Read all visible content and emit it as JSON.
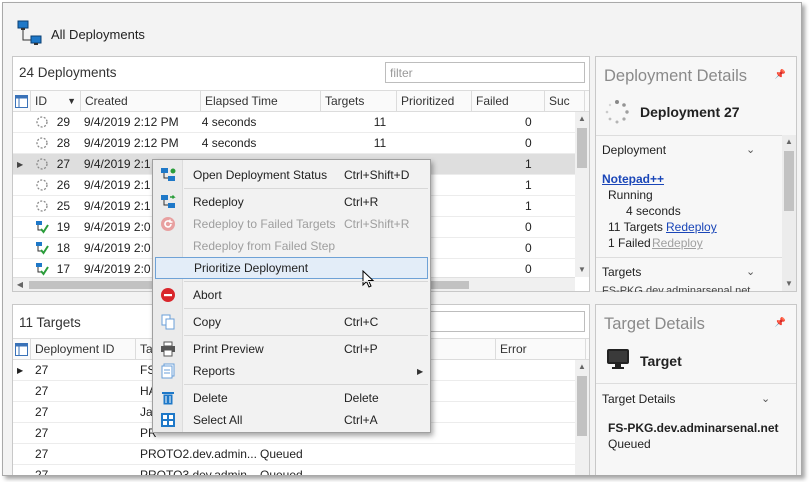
{
  "header": {
    "title": "All Deployments"
  },
  "deployments": {
    "title": "24 Deployments",
    "filter_placeholder": "filter",
    "columns": [
      "ID",
      "Created",
      "Elapsed Time",
      "Targets",
      "Prioritized",
      "Failed",
      "Suc"
    ],
    "rows": [
      {
        "id": "29",
        "created": "9/4/2019 2:12 PM",
        "elapsed": "4 seconds",
        "targets": "11",
        "prioritized": "",
        "failed": "0",
        "status": "running"
      },
      {
        "id": "28",
        "created": "9/4/2019 2:12 PM",
        "elapsed": "4 seconds",
        "targets": "11",
        "prioritized": "",
        "failed": "0",
        "status": "running"
      },
      {
        "id": "27",
        "created": "9/4/2019 2:1",
        "elapsed": "",
        "targets": "",
        "prioritized": "",
        "failed": "1",
        "status": "running"
      },
      {
        "id": "26",
        "created": "9/4/2019 2:1",
        "elapsed": "",
        "targets": "",
        "prioritized": "",
        "failed": "1",
        "status": "running"
      },
      {
        "id": "25",
        "created": "9/4/2019 2:1",
        "elapsed": "",
        "targets": "",
        "prioritized": "",
        "failed": "1",
        "status": "running"
      },
      {
        "id": "19",
        "created": "9/4/2019 2:0",
        "elapsed": "",
        "targets": "",
        "prioritized": "",
        "failed": "0",
        "status": "success"
      },
      {
        "id": "18",
        "created": "9/4/2019 2:0",
        "elapsed": "",
        "targets": "",
        "prioritized": "",
        "failed": "0",
        "status": "success"
      },
      {
        "id": "17",
        "created": "9/4/2019 2:0",
        "elapsed": "",
        "targets": "",
        "prioritized": "",
        "failed": "0",
        "status": "success"
      }
    ]
  },
  "targets": {
    "title": "11 Targets",
    "columns": [
      "Deployment ID",
      "Ta",
      "",
      "Error"
    ],
    "rows": [
      {
        "deployment_id": "27",
        "target": "FS",
        "status": ""
      },
      {
        "deployment_id": "27",
        "target": "HA",
        "status": ""
      },
      {
        "deployment_id": "27",
        "target": "Ja",
        "status": ""
      },
      {
        "deployment_id": "27",
        "target": "PR",
        "status": ""
      },
      {
        "deployment_id": "27",
        "target": "PROTO2.dev.admin...",
        "status": "Queued"
      },
      {
        "deployment_id": "27",
        "target": "PROTO3.dev.admin...",
        "status": "Queued"
      }
    ]
  },
  "deployment_details": {
    "title": "Deployment Details",
    "name": "Deployment 27",
    "section": "Deployment",
    "package_link": "Notepad++",
    "state": "Running",
    "elapsed": "4 seconds",
    "targets_text": "11 Targets",
    "redeploy_link": "Redeploy",
    "failed_text": "1 Failed",
    "redeploy_failed_link": "Redeploy",
    "targets_section": "Targets",
    "targets_cut": "FS-PKG.dev.adminarsenal.net"
  },
  "target_details": {
    "title": "Target Details",
    "name": "Target",
    "section": "Target Details",
    "host": "FS-PKG.dev.adminarsenal.net",
    "status": "Queued"
  },
  "context_menu": {
    "items": [
      {
        "label": "Open Deployment Status",
        "shortcut": "Ctrl+Shift+D",
        "icon": "open-status-icon",
        "enabled": true
      },
      {
        "label": "Redeploy",
        "shortcut": "Ctrl+R",
        "icon": "redeploy-icon",
        "enabled": true
      },
      {
        "label": "Redeploy to Failed Targets",
        "shortcut": "Ctrl+Shift+R",
        "icon": "redeploy-failed-icon",
        "enabled": false
      },
      {
        "label": "Redeploy from Failed Step",
        "shortcut": "",
        "icon": "",
        "enabled": false
      },
      {
        "label": "Prioritize Deployment",
        "shortcut": "",
        "icon": "",
        "enabled": true
      },
      {
        "label": "Abort",
        "shortcut": "",
        "icon": "abort-icon",
        "enabled": true
      },
      {
        "label": "Copy",
        "shortcut": "Ctrl+C",
        "icon": "copy-icon",
        "enabled": true
      },
      {
        "label": "Print Preview",
        "shortcut": "Ctrl+P",
        "icon": "printer-icon",
        "enabled": true
      },
      {
        "label": "Reports",
        "shortcut": "",
        "icon": "reports-icon",
        "enabled": true
      },
      {
        "label": "Delete",
        "shortcut": "Delete",
        "icon": "trash-icon",
        "enabled": true
      },
      {
        "label": "Select All",
        "shortcut": "Ctrl+A",
        "icon": "select-all-icon",
        "enabled": true
      }
    ]
  },
  "colors": {
    "link": "#1a46b8",
    "highlight": "#e3edf8",
    "abort": "#d9262b",
    "success_check": "#2a9d3a"
  }
}
